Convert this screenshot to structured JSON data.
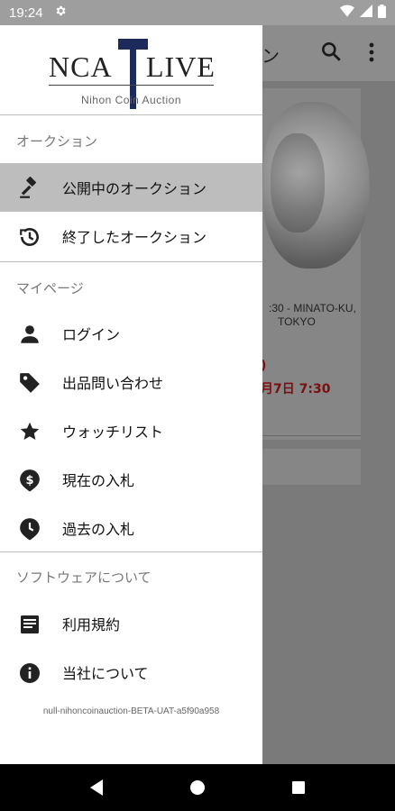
{
  "status_bar": {
    "time": "19:24"
  },
  "background_app": {
    "title_fragment": "ン",
    "location_line1": ":30 - MINATO-KU,",
    "location_line2": "TOKYO",
    "red_line1": ")",
    "red_line2": "月7日  7:30"
  },
  "drawer": {
    "logo": {
      "left": "NCA",
      "right": "LIVE",
      "subtitle": "Nihon Coin Auction"
    },
    "sections": [
      {
        "header": "オークション",
        "items": [
          {
            "label": "公開中のオークション",
            "icon": "gavel-icon",
            "selected": true
          },
          {
            "label": "終了したオークション",
            "icon": "history-icon",
            "selected": false
          }
        ]
      },
      {
        "header": "マイページ",
        "items": [
          {
            "label": "ログイン",
            "icon": "person-icon"
          },
          {
            "label": "出品問い合わせ",
            "icon": "tag-icon"
          },
          {
            "label": "ウォッチリスト",
            "icon": "star-icon"
          },
          {
            "label": "現在の入札",
            "icon": "dollar-pin-icon"
          },
          {
            "label": "過去の入札",
            "icon": "clock-pin-icon"
          }
        ]
      },
      {
        "header": "ソフトウェアについて",
        "items": [
          {
            "label": "利用規約",
            "icon": "document-icon"
          },
          {
            "label": "当社について",
            "icon": "info-icon"
          }
        ]
      }
    ],
    "version": "null-nihoncoinauction-BETA-UAT-a5f90a958"
  },
  "colors": {
    "accent_navy": "#1c2a5c",
    "selected_bg": "#bdbdbd",
    "status_bar": "#9e9e9e"
  }
}
